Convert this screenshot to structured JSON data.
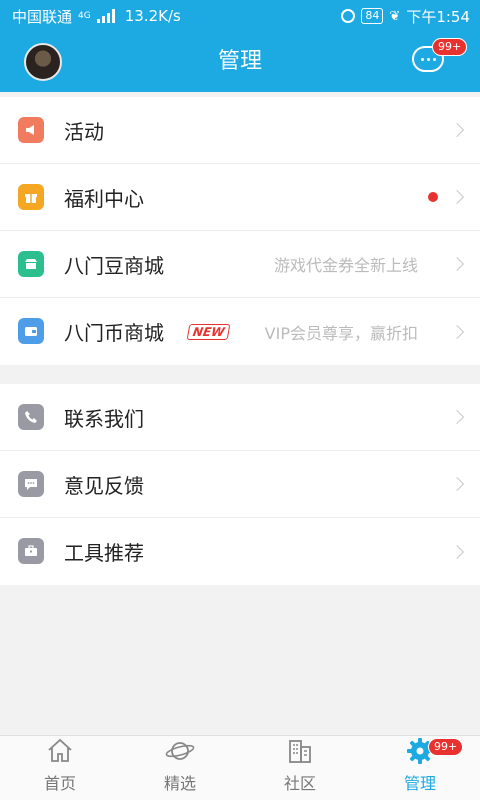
{
  "status_bar": {
    "carrier": "中国联通",
    "network": "4G",
    "speed": "13.2K/s",
    "battery": "84",
    "time": "下午1:54"
  },
  "header": {
    "title": "管理",
    "message_badge": "99+"
  },
  "menu_group_1": [
    {
      "label": "活动",
      "icon": "megaphone-icon",
      "color": "#f07b5e",
      "subtitle": ""
    },
    {
      "label": "福利中心",
      "icon": "gift-icon",
      "color": "#f5a623",
      "subtitle": "",
      "dot": true
    },
    {
      "label": "八门豆商城",
      "icon": "store-icon",
      "color": "#2bbf8e",
      "subtitle": "游戏代金券全新上线"
    },
    {
      "label": "八门币商城",
      "icon": "wallet-icon",
      "color": "#4e9de8",
      "subtitle": "VIP会员尊享，赢折扣",
      "tag": "NEW"
    }
  ],
  "menu_group_2": [
    {
      "label": "联系我们",
      "icon": "phone-icon",
      "color": "#9a9aa5"
    },
    {
      "label": "意见反馈",
      "icon": "feedback-icon",
      "color": "#9a9aa5"
    },
    {
      "label": "工具推荐",
      "icon": "toolbox-icon",
      "color": "#9a9aa5"
    }
  ],
  "tabbar": {
    "tabs": [
      {
        "label": "首页",
        "icon": "home-icon"
      },
      {
        "label": "精选",
        "icon": "planet-icon"
      },
      {
        "label": "社区",
        "icon": "buildings-icon"
      },
      {
        "label": "管理",
        "icon": "gear-icon",
        "active": true,
        "badge": "99+"
      }
    ]
  },
  "colors": {
    "accent": "#1da9e2",
    "badge": "#e8322f"
  }
}
